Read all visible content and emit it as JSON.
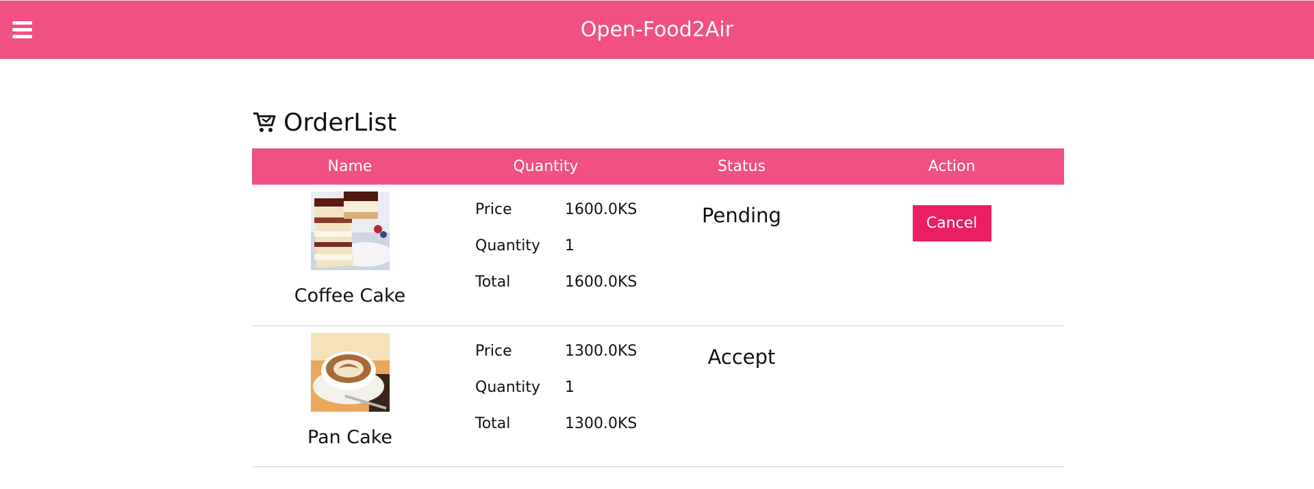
{
  "header": {
    "title": "Open-Food2Air",
    "menu_icon": "hamburger-menu-icon",
    "color": "#f05082"
  },
  "page": {
    "heading": "OrderList",
    "heading_icon": "cart-icon"
  },
  "table": {
    "columns": [
      "Name",
      "Quantity",
      "Status",
      "Action"
    ],
    "rows": [
      {
        "image": "coffee-cake-image",
        "name": "Coffee Cake",
        "price_label": "Price",
        "price": "1600.0KS",
        "quantity_label": "Quantity",
        "quantity": "1",
        "total_label": "Total",
        "total": "1600.0KS",
        "status": "Pending",
        "action": "Cancel"
      },
      {
        "image": "pan-cake-image",
        "name": "Pan Cake",
        "price_label": "Price",
        "price": "1300.0KS",
        "quantity_label": "Quantity",
        "quantity": "1",
        "total_label": "Total",
        "total": "1300.0KS",
        "status": "Accept",
        "action": ""
      }
    ]
  },
  "colors": {
    "accent": "#f05082",
    "button": "#e91e63"
  }
}
